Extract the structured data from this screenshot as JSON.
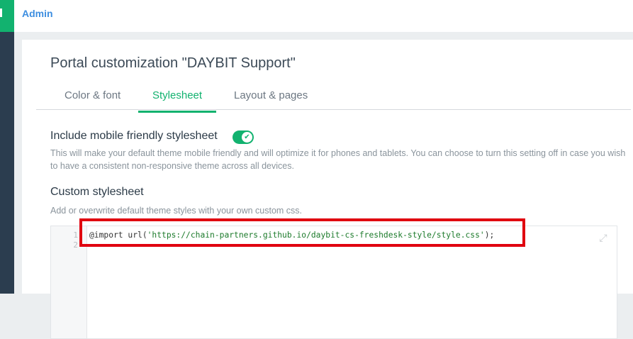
{
  "header": {
    "admin_label": "Admin"
  },
  "page": {
    "title": "Portal customization \"DAYBIT Support\""
  },
  "tabs": [
    {
      "label": "Color & font"
    },
    {
      "label": "Stylesheet"
    },
    {
      "label": "Layout & pages"
    }
  ],
  "mobile": {
    "label": "Include mobile friendly stylesheet",
    "enabled": true,
    "description": "This will make your default theme mobile friendly and will optimize it for phones and tablets. You can choose to turn this setting off in case you wish to have a consistent non-responsive theme across all devices."
  },
  "custom": {
    "label": "Custom stylesheet",
    "help": "Add or overwrite default theme styles with your own custom css.",
    "line_numbers": [
      "1",
      "2"
    ],
    "code_prefix": "@import url(",
    "code_string": "'https://chain-partners.github.io/daybit-cs-freshdesk-style/style.css'",
    "code_suffix": ");"
  },
  "colors": {
    "accent": "#12b26f",
    "sidebar": "#2b3d4f",
    "highlight": "#e0000f"
  }
}
